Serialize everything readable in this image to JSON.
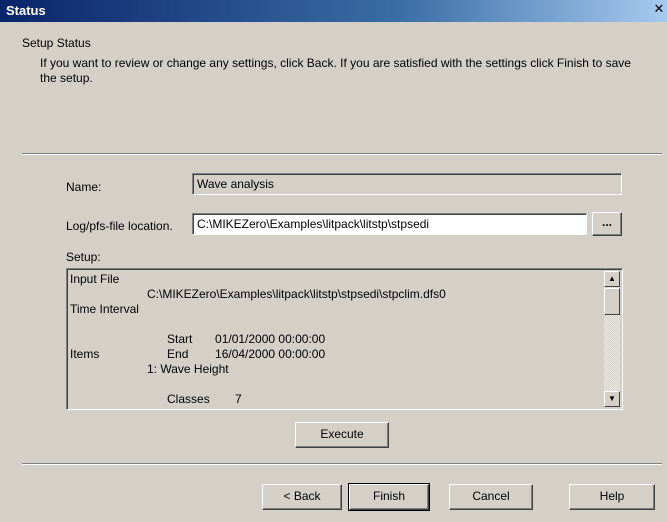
{
  "window": {
    "title": "Status",
    "close_glyph": "✕"
  },
  "header": {
    "heading": "Setup Status",
    "description": "If you want to review or change any settings, click Back. If you are satisfied with the settings click Finish to save the setup."
  },
  "form": {
    "name_label": "Name:",
    "name_value": "Wave analysis",
    "location_label": "Log/pfs-file location.",
    "location_value": "C:\\MIKEZero\\Examples\\litpack\\litstp\\stpsedi",
    "browse_label": "...",
    "setup_label": "Setup:"
  },
  "setup": {
    "input_file_heading": "Input File",
    "input_file_path": "C:\\MIKEZero\\Examples\\litpack\\litstp\\stpsedi\\stpclim.dfs0",
    "time_interval_heading": "Time Interval",
    "start_label": "Start",
    "start_value": "01/01/2000 00:00:00",
    "end_label": "End",
    "end_value": "16/04/2000 00:00:00",
    "items_heading": "Items",
    "item_1": "1: Wave Height",
    "classes_label": "Classes",
    "classes_value": "7"
  },
  "scrollbar": {
    "up_icon": "▲",
    "down_icon": "▼"
  },
  "buttons": {
    "execute": "Execute",
    "back": "< Back",
    "finish": "Finish",
    "cancel": "Cancel",
    "help": "Help"
  }
}
